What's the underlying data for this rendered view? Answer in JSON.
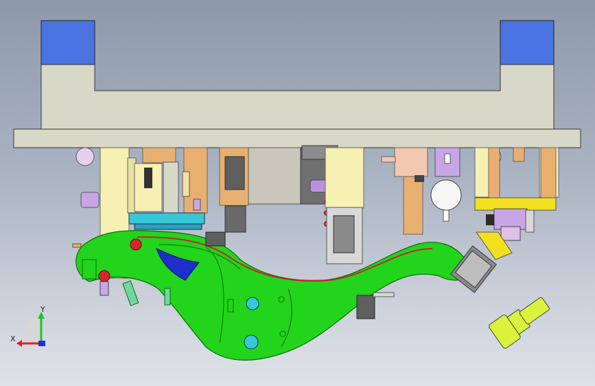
{
  "viewport": {
    "background_top": "#8d99ab",
    "background_bottom": "#dfe2e8"
  },
  "colors": {
    "frame": "#d8d8c8",
    "frame_pads": "#4a72e0",
    "part": "#22d41c",
    "part_shade": "#16a012",
    "clamp_yellow": "#f6f0b2",
    "clamp_orange": "#e8b070",
    "violet": "#c8a6e6",
    "accent_blue": "#1d2fc8",
    "accent_red": "#d8242e",
    "pin_yellow": "#d9f23c"
  },
  "axis_triad": {
    "x_label": "X",
    "y_label": "Y",
    "x_color": "#e0202a",
    "y_color": "#22c02a",
    "z_color": "#2030e0"
  }
}
